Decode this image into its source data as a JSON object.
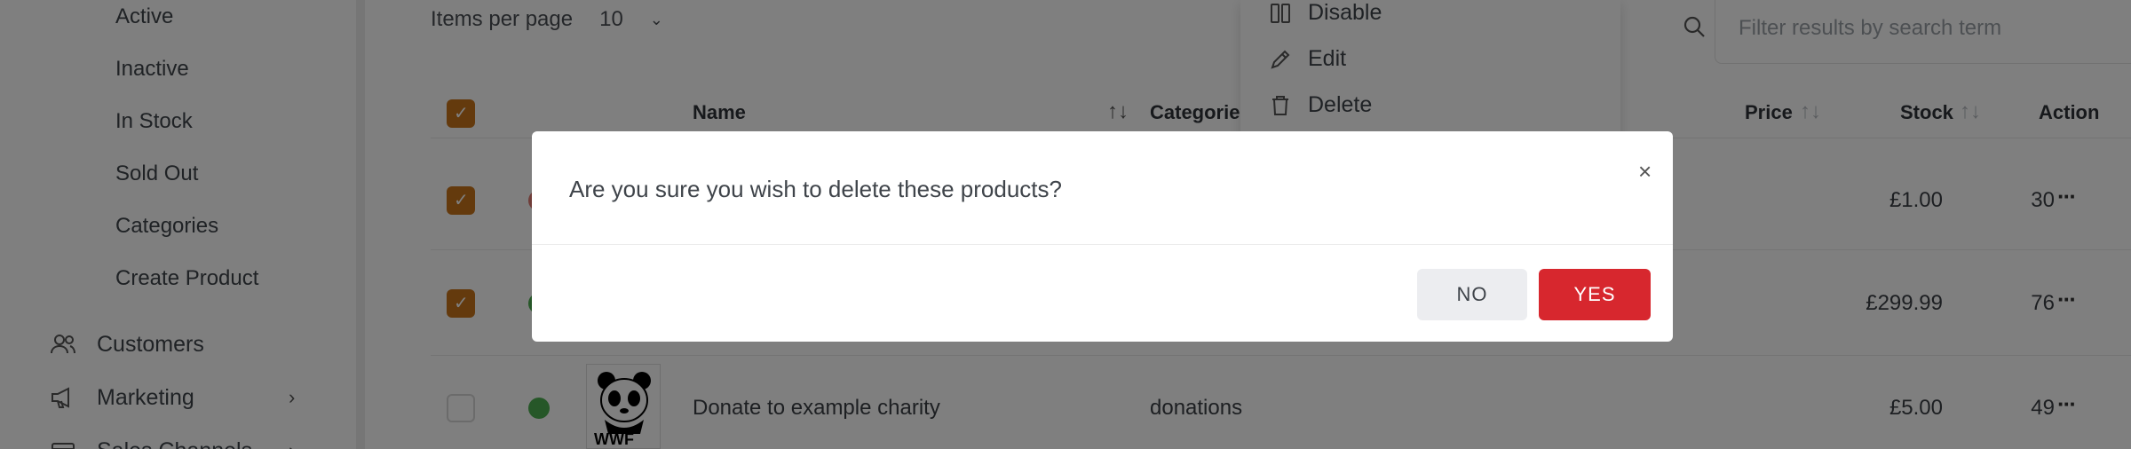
{
  "sidebar": {
    "sub_items": [
      "Active",
      "Inactive",
      "In Stock",
      "Sold Out",
      "Categories",
      "Create Product"
    ],
    "main_items": [
      {
        "label": "Customers",
        "icon": "users-icon"
      },
      {
        "label": "Marketing",
        "icon": "megaphone-icon"
      },
      {
        "label": "Sales Channels",
        "icon": "storefront-icon"
      }
    ]
  },
  "toolbar": {
    "items_per_page_label": "Items per page",
    "items_per_page_value": "10",
    "search_placeholder": "Filter results by search term"
  },
  "context_menu": {
    "items": [
      {
        "label": "Disable",
        "icon": "columns-icon"
      },
      {
        "label": "Edit",
        "icon": "pencil-icon"
      },
      {
        "label": "Delete",
        "icon": "trash-icon"
      }
    ]
  },
  "table": {
    "columns": {
      "name": "Name",
      "categories": "Categories",
      "price": "Price",
      "stock": "Stock",
      "action": "Action"
    },
    "rows": [
      {
        "checked": true,
        "status_color": "#e07b73",
        "name": "",
        "category": "",
        "price": "£1.00",
        "stock": "30"
      },
      {
        "checked": true,
        "status_color": "#4caf50",
        "name": "",
        "category": "",
        "price": "£299.99",
        "stock": "76"
      },
      {
        "checked": false,
        "status_color": "#4caf50",
        "name": "Donate to example charity",
        "category": "donations",
        "price": "£5.00",
        "stock": "49",
        "image_text": "WWF"
      }
    ]
  },
  "modal": {
    "message": "Are you sure you wish to delete these products?",
    "no_label": "NO",
    "yes_label": "YES",
    "close_glyph": "×"
  },
  "colors": {
    "accent": "#c9751a",
    "danger": "#d7272e",
    "overlay": "rgba(0,0,0,0.5)"
  }
}
